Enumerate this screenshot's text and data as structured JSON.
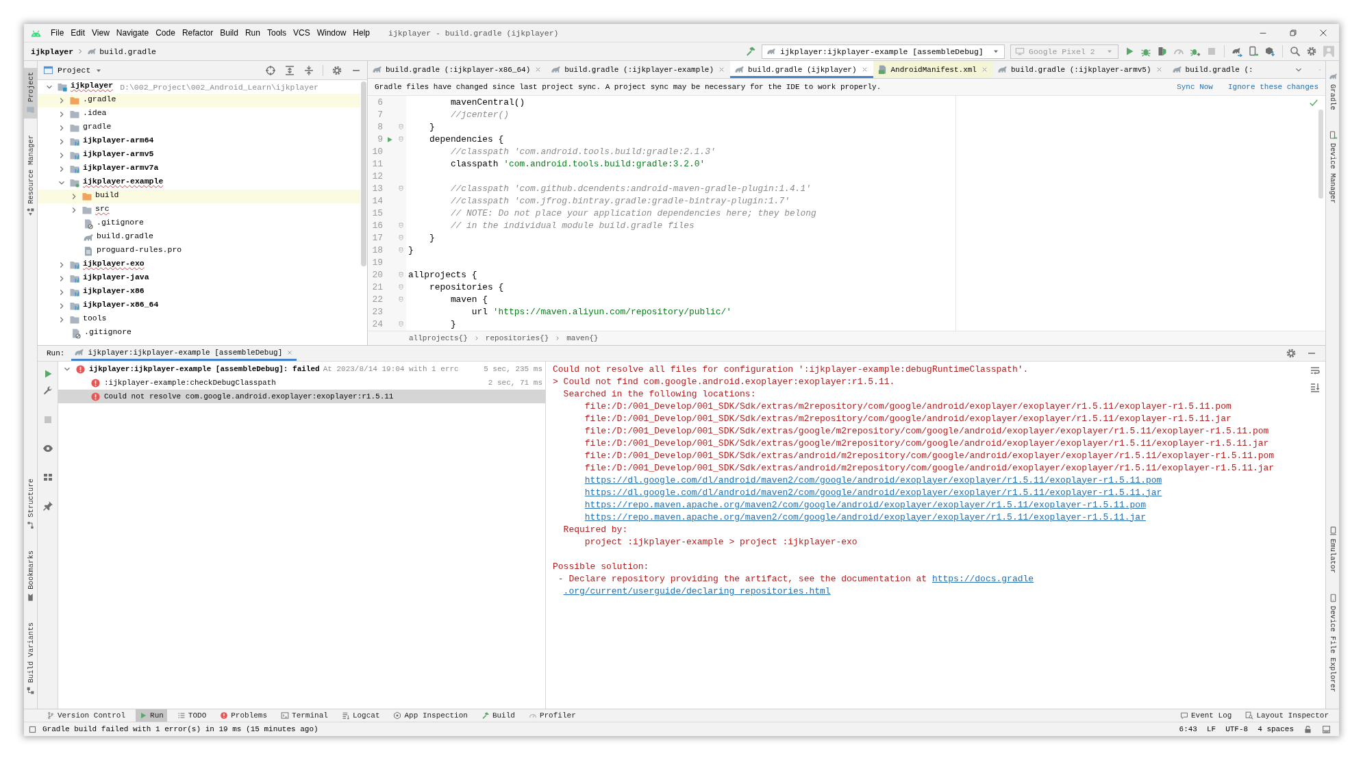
{
  "window": {
    "title": "ijkplayer - build.gradle (ijkplayer)",
    "menu": [
      "File",
      "Edit",
      "View",
      "Navigate",
      "Code",
      "Refactor",
      "Build",
      "Run",
      "Tools",
      "VCS",
      "Window",
      "Help"
    ]
  },
  "nav_bar": {
    "breadcrumbs": [
      "ijkplayer",
      "build.gradle"
    ],
    "run_configuration": "ijkplayer:ijkplayer-example [assembleDebug]",
    "device": "Google Pixel 2"
  },
  "left_strip": {
    "top": [
      {
        "label": "Project",
        "selected": true
      },
      {
        "label": "Resource Manager",
        "selected": false
      }
    ],
    "bottom": [
      {
        "label": "Structure",
        "selected": false
      },
      {
        "label": "Bookmarks",
        "selected": false
      },
      {
        "label": "Build Variants",
        "selected": false
      }
    ]
  },
  "right_strip": {
    "top": [
      {
        "label": "Gradle",
        "selected": false
      },
      {
        "label": "Device Manager",
        "selected": false
      }
    ],
    "bottom": [
      {
        "label": "Emulator",
        "selected": false
      },
      {
        "label": "Device File Explorer",
        "selected": false
      }
    ]
  },
  "project_panel": {
    "title": "Project",
    "tree": [
      {
        "kind": "project_root",
        "label": "ijkplayer",
        "path": "D:\\002_Project\\002_Android_Learn\\ijkplayer",
        "expanded": true,
        "error_underline": true,
        "children": [
          {
            "kind": "excluded_folder",
            "label": ".gradle",
            "expanded": false,
            "error_underline": false
          },
          {
            "kind": "folder",
            "label": ".idea",
            "expanded": false,
            "error_underline": false
          },
          {
            "kind": "folder",
            "label": "gradle",
            "expanded": false,
            "error_underline": false
          },
          {
            "kind": "module",
            "label": "ijkplayer-arm64",
            "expanded": false,
            "error_underline": false
          },
          {
            "kind": "module",
            "label": "ijkplayer-armv5",
            "expanded": false,
            "error_underline": false
          },
          {
            "kind": "module",
            "label": "ijkplayer-armv7a",
            "expanded": false,
            "error_underline": false
          },
          {
            "kind": "app_module",
            "label": "ijkplayer-example",
            "expanded": true,
            "error_underline": true,
            "children": [
              {
                "kind": "excluded_folder",
                "label": "build",
                "expanded": false,
                "error_underline": false
              },
              {
                "kind": "folder",
                "label": "src",
                "expanded": false,
                "error_underline": true
              },
              {
                "kind": "ignore_file",
                "label": ".gitignore",
                "error_underline": false
              },
              {
                "kind": "gradle_file",
                "label": "build.gradle",
                "error_underline": false
              },
              {
                "kind": "text_file",
                "label": "proguard-rules.pro",
                "error_underline": false
              }
            ]
          },
          {
            "kind": "module",
            "label": "ijkplayer-exo",
            "expanded": false,
            "error_underline": true
          },
          {
            "kind": "module",
            "label": "ijkplayer-java",
            "expanded": false,
            "error_underline": false
          },
          {
            "kind": "module",
            "label": "ijkplayer-x86",
            "expanded": false,
            "error_underline": false
          },
          {
            "kind": "module",
            "label": "ijkplayer-x86_64",
            "expanded": false,
            "error_underline": false
          },
          {
            "kind": "folder",
            "label": "tools",
            "expanded": false,
            "error_underline": false
          },
          {
            "kind": "ignore_file",
            "label": ".gitignore",
            "error_underline": false
          }
        ]
      }
    ]
  },
  "editor": {
    "tabs": [
      {
        "kind": "gradle",
        "label": "build.gradle (:ijkplayer-x86_64)",
        "selected": false,
        "closable": true
      },
      {
        "kind": "gradle",
        "label": "build.gradle (:ijkplayer-example)",
        "selected": false,
        "closable": true
      },
      {
        "kind": "gradle",
        "label": "build.gradle (ijkplayer)",
        "selected": true,
        "closable": true
      },
      {
        "kind": "manifest",
        "label": "AndroidManifest.xml",
        "selected": false,
        "closable": true
      },
      {
        "kind": "gradle",
        "label": "build.gradle (:ijkplayer-armv5)",
        "selected": false,
        "closable": true
      },
      {
        "kind": "gradle",
        "label": "build.gradle (:",
        "selected": false,
        "closable": false
      }
    ],
    "notification": {
      "message": "Gradle files have changed since last project sync. A project sync may be necessary for the IDE to work properly.",
      "actions": [
        "Sync Now",
        "Ignore these changes"
      ]
    },
    "lines": [
      {
        "number": "6",
        "fold": false,
        "run": false,
        "tokens": [
          {
            "kind": "plain",
            "text": "        mavenCentral()"
          }
        ]
      },
      {
        "number": "7",
        "fold": false,
        "run": false,
        "tokens": [
          {
            "kind": "comment",
            "text": "        //jcenter()"
          }
        ]
      },
      {
        "number": "8",
        "fold": true,
        "run": false,
        "tokens": [
          {
            "kind": "plain",
            "text": "    }"
          }
        ]
      },
      {
        "number": "9",
        "fold": true,
        "run": true,
        "tokens": [
          {
            "kind": "plain",
            "text": "    dependencies {"
          }
        ]
      },
      {
        "number": "10",
        "fold": false,
        "run": false,
        "tokens": [
          {
            "kind": "comment",
            "text": "        //classpath 'com.android.tools.build:gradle:2.1.3'"
          }
        ]
      },
      {
        "number": "11",
        "fold": false,
        "run": false,
        "tokens": [
          {
            "kind": "plain",
            "text": "        classpath "
          },
          {
            "kind": "string",
            "text": "'com.android.tools.build:gradle:3.2.0'"
          }
        ]
      },
      {
        "number": "12",
        "fold": false,
        "run": false
      },
      {
        "number": "13",
        "fold": true,
        "run": false,
        "tokens": [
          {
            "kind": "comment",
            "text": "        //classpath 'com.github.dcendents:android-maven-gradle-plugin:1.4.1'"
          }
        ]
      },
      {
        "number": "14",
        "fold": false,
        "run": false,
        "tokens": [
          {
            "kind": "comment",
            "text": "        //classpath 'com.jfrog.bintray.gradle:gradle-bintray-plugin:1.7'"
          }
        ]
      },
      {
        "number": "15",
        "fold": false,
        "run": false,
        "tokens": [
          {
            "kind": "comment",
            "text": "        // NOTE: Do not place your application dependencies here; they belong"
          }
        ]
      },
      {
        "number": "16",
        "fold": true,
        "run": false,
        "tokens": [
          {
            "kind": "comment",
            "text": "        // in the individual module build.gradle files"
          }
        ]
      },
      {
        "number": "17",
        "fold": true,
        "run": false,
        "tokens": [
          {
            "kind": "plain",
            "text": "    }"
          }
        ]
      },
      {
        "number": "18",
        "fold": true,
        "run": false,
        "tokens": [
          {
            "kind": "plain",
            "text": "}"
          }
        ]
      },
      {
        "number": "19",
        "fold": false,
        "run": false
      },
      {
        "number": "20",
        "fold": true,
        "run": false,
        "tokens": [
          {
            "kind": "plain",
            "text": "allprojects {"
          }
        ]
      },
      {
        "number": "21",
        "fold": true,
        "run": false,
        "tokens": [
          {
            "kind": "plain",
            "text": "    repositories {"
          }
        ]
      },
      {
        "number": "22",
        "fold": true,
        "run": false,
        "tokens": [
          {
            "kind": "plain",
            "text": "        maven {"
          }
        ]
      },
      {
        "number": "23",
        "fold": false,
        "run": false,
        "tokens": [
          {
            "kind": "plain",
            "text": "            url "
          },
          {
            "kind": "string",
            "text": "'https://maven.aliyun.com/repository/public/'"
          }
        ]
      },
      {
        "number": "24",
        "fold": true,
        "run": false,
        "tokens": [
          {
            "kind": "plain",
            "text": "        }"
          }
        ]
      }
    ],
    "breadcrumbs": [
      "allprojects{}",
      "repositories{}",
      "maven{}"
    ]
  },
  "run_panel": {
    "label": "Run:",
    "tabs": [
      {
        "label": "ijkplayer:ijkplayer-example [assembleDebug]",
        "selected": true
      }
    ],
    "tree": [
      {
        "title": "ijkplayer:ijkplayer-example [assembleDebug]: failed",
        "detail": "At 2023/8/14 19:04 with 1 errc",
        "time": "5 sec, 235 ms",
        "expanded": true,
        "selected": false,
        "children": [
          {
            "title": ":ijkplayer-example:checkDebugClasspath",
            "time": "2 sec, 71 ms",
            "selected": false
          },
          {
            "title": "Could not resolve com.google.android.exoplayer:exoplayer:r1.5.11",
            "selected": true
          }
        ]
      }
    ],
    "output": [
      {
        "kind": "text",
        "tokens": [
          {
            "kind": "text",
            "text": "Could not resolve all files for configuration ':ijkplayer-example:debugRuntimeClasspath'."
          }
        ]
      },
      {
        "kind": "text",
        "tokens": [
          {
            "kind": "text",
            "text": "> Could not find com.google.android.exoplayer:exoplayer:r1.5.11."
          }
        ]
      },
      {
        "kind": "text",
        "tokens": [
          {
            "kind": "text",
            "text": "  Searched in the following locations:"
          }
        ]
      },
      {
        "kind": "text",
        "tokens": [
          {
            "kind": "text",
            "text": "      file:/D:/001_Develop/001_SDK/Sdk/extras/m2repository/com/google/android/exoplayer/exoplayer/r1.5.11/exoplayer-r1.5.11.pom"
          }
        ]
      },
      {
        "kind": "text",
        "tokens": [
          {
            "kind": "text",
            "text": "      file:/D:/001_Develop/001_SDK/Sdk/extras/m2repository/com/google/android/exoplayer/exoplayer/r1.5.11/exoplayer-r1.5.11.jar"
          }
        ]
      },
      {
        "kind": "text",
        "tokens": [
          {
            "kind": "text",
            "text": "      file:/D:/001_Develop/001_SDK/Sdk/extras/google/m2repository/com/google/android/exoplayer/exoplayer/r1.5.11/exoplayer-r1.5.11.pom"
          }
        ]
      },
      {
        "kind": "text",
        "tokens": [
          {
            "kind": "text",
            "text": "      file:/D:/001_Develop/001_SDK/Sdk/extras/google/m2repository/com/google/android/exoplayer/exoplayer/r1.5.11/exoplayer-r1.5.11.jar"
          }
        ]
      },
      {
        "kind": "text",
        "tokens": [
          {
            "kind": "text",
            "text": "      file:/D:/001_Develop/001_SDK/Sdk/extras/android/m2repository/com/google/android/exoplayer/exoplayer/r1.5.11/exoplayer-r1.5.11.pom"
          }
        ]
      },
      {
        "kind": "text",
        "tokens": [
          {
            "kind": "text",
            "text": "      file:/D:/001_Develop/001_SDK/Sdk/extras/android/m2repository/com/google/android/exoplayer/exoplayer/r1.5.11/exoplayer-r1.5.11.jar"
          }
        ]
      },
      {
        "kind": "location_link",
        "tokens": [
          {
            "kind": "link",
            "text": "https://dl.google.com/dl/android/maven2/com/google/android/exoplayer/exoplayer/r1.5.11/exoplayer-r1.5.11.pom"
          }
        ]
      },
      {
        "kind": "location_link",
        "tokens": [
          {
            "kind": "link",
            "text": "https://dl.google.com/dl/android/maven2/com/google/android/exoplayer/exoplayer/r1.5.11/exoplayer-r1.5.11.jar"
          }
        ]
      },
      {
        "kind": "location_link",
        "tokens": [
          {
            "kind": "link",
            "text": "https://repo.maven.apache.org/maven2/com/google/android/exoplayer/exoplayer/r1.5.11/exoplayer-r1.5.11.pom"
          }
        ]
      },
      {
        "kind": "location_link",
        "tokens": [
          {
            "kind": "link",
            "text": "https://repo.maven.apache.org/maven2/com/google/android/exoplayer/exoplayer/r1.5.11/exoplayer-r1.5.11.jar"
          }
        ]
      },
      {
        "kind": "text",
        "tokens": [
          {
            "kind": "text",
            "text": "  Required by:"
          }
        ]
      },
      {
        "kind": "text",
        "tokens": [
          {
            "kind": "text",
            "text": "      project :ijkplayer-example > project :ijkplayer-exo"
          }
        ]
      },
      {
        "kind": "blank"
      },
      {
        "kind": "text",
        "tokens": [
          {
            "kind": "text",
            "text": "Possible solution:"
          }
        ]
      },
      {
        "kind": "text",
        "tokens": [
          {
            "kind": "text",
            "text": " - Declare repository providing the artifact, see the documentation at "
          },
          {
            "kind": "link",
            "text": "https://docs.gradle"
          }
        ]
      },
      {
        "kind": "continuation_link",
        "tokens": [
          {
            "kind": "link",
            "text": ".org/current/userguide/declaring_repositories.html"
          }
        ]
      }
    ]
  },
  "tool_windows": {
    "left": [
      {
        "label": "Version Control",
        "selected": false
      },
      {
        "label": "Run",
        "selected": true
      },
      {
        "label": "TODO",
        "selected": false
      },
      {
        "label": "Problems",
        "selected": false
      },
      {
        "label": "Terminal",
        "selected": false
      },
      {
        "label": "Logcat",
        "selected": false
      },
      {
        "label": "App Inspection",
        "selected": false
      },
      {
        "label": "Build",
        "selected": false
      },
      {
        "label": "Profiler",
        "selected": false
      }
    ],
    "right": [
      {
        "label": "Event Log",
        "selected": false
      },
      {
        "label": "Layout Inspector",
        "selected": false
      }
    ]
  },
  "status_bar": {
    "message": "Gradle build failed with 1 error(s) in 19 ms (15 minutes ago)",
    "items": [
      "6:43",
      "LF",
      "UTF-8",
      "4 spaces"
    ]
  }
}
